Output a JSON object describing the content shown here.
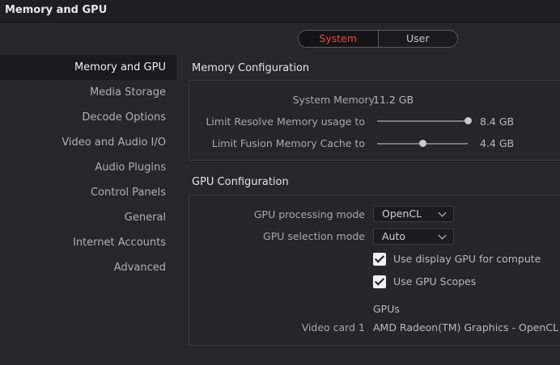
{
  "window": {
    "title": "Memory and GPU"
  },
  "scope_toggle": {
    "options": [
      "System",
      "User"
    ],
    "selected": "System"
  },
  "sidebar": {
    "items": [
      {
        "label": "Memory and GPU",
        "active": true
      },
      {
        "label": "Media Storage",
        "active": false
      },
      {
        "label": "Decode Options",
        "active": false
      },
      {
        "label": "Video and Audio I/O",
        "active": false
      },
      {
        "label": "Audio Plugins",
        "active": false
      },
      {
        "label": "Control Panels",
        "active": false
      },
      {
        "label": "General",
        "active": false
      },
      {
        "label": "Internet Accounts",
        "active": false
      },
      {
        "label": "Advanced",
        "active": false
      }
    ]
  },
  "memory": {
    "section_title": "Memory Configuration",
    "system_memory_label": "System Memory",
    "system_memory_value": "11.2 GB",
    "resolve_limit_label": "Limit Resolve Memory usage to",
    "resolve_limit_value": "8.4 GB",
    "resolve_limit_fraction": 1.0,
    "fusion_limit_label": "Limit Fusion Memory Cache to",
    "fusion_limit_value": "4.4 GB",
    "fusion_limit_fraction": 0.5
  },
  "gpu": {
    "section_title": "GPU Configuration",
    "processing_mode_label": "GPU processing mode",
    "processing_mode_value": "OpenCL",
    "selection_mode_label": "GPU selection mode",
    "selection_mode_value": "Auto",
    "use_display_gpu_label": "Use display GPU for compute",
    "use_display_gpu_checked": true,
    "use_gpu_scopes_label": "Use GPU Scopes",
    "use_gpu_scopes_checked": true,
    "gpus_header": "GPUs",
    "video_card_label": "Video card 1",
    "video_card_value": "AMD Radeon(TM) Graphics - OpenCL"
  }
}
